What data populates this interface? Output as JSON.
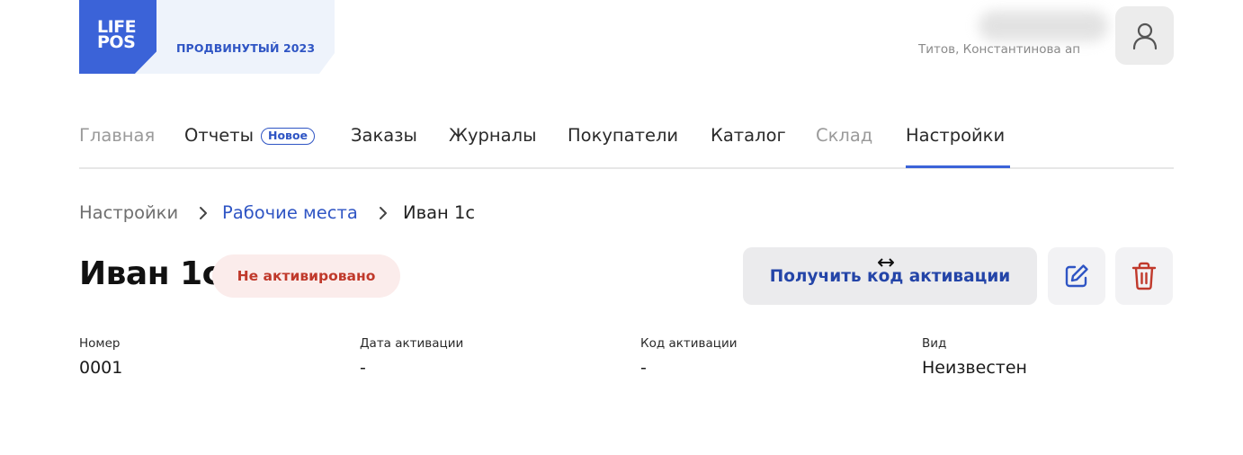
{
  "header": {
    "logo_line1": "LIFE",
    "logo_line2": "POS",
    "plan": "ПРОДВИНУТЫЙ 2023",
    "user_name": "Титов, Константинова ап"
  },
  "nav": {
    "items": [
      {
        "label": "Главная",
        "state": "muted"
      },
      {
        "label": "Отчеты",
        "badge": "Новое"
      },
      {
        "label": "Заказы"
      },
      {
        "label": "Журналы"
      },
      {
        "label": "Покупатели"
      },
      {
        "label": "Каталог"
      },
      {
        "label": "Склад",
        "state": "muted"
      },
      {
        "label": "Настройки",
        "active": true
      }
    ]
  },
  "breadcrumb": {
    "items": [
      "Настройки",
      "Рабочие места",
      "Иван 1с"
    ]
  },
  "page": {
    "title": "Иван 1с",
    "status": "Не активировано",
    "activate_label": "Получить код активации"
  },
  "fields": [
    {
      "label": "Номер",
      "value": "0001"
    },
    {
      "label": "Дата активации",
      "value": "-"
    },
    {
      "label": "Код активации",
      "value": "-"
    },
    {
      "label": "Вид",
      "value": "Неизвестен"
    }
  ],
  "colors": {
    "accent": "#3b63d8",
    "link": "#2f55c4",
    "danger": "#c0392b",
    "status_bg": "#fbeceb"
  },
  "icons": {
    "avatar": "user-icon",
    "edit": "edit-icon",
    "delete": "trash-icon",
    "breadcrumb_separator": "chevron-right-icon",
    "cursor": "resize-horizontal-cursor-icon"
  }
}
